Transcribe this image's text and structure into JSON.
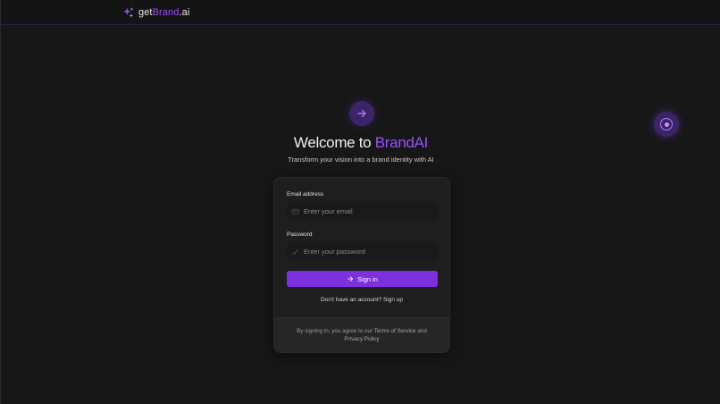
{
  "header": {
    "brand_prefix": "get",
    "brand_highlight": "Brand",
    "brand_suffix": ".ai",
    "logo_icon": "sparkles-icon"
  },
  "hero": {
    "icon": "arrow-right-icon",
    "title_prefix": "Welcome to ",
    "title_highlight": "BrandAI",
    "subtitle": "Transform your vision into a brand identity with AI"
  },
  "form": {
    "email_label": "Email address",
    "email_placeholder": "Enter your email",
    "email_value": "",
    "email_icon": "mail-icon",
    "password_label": "Password",
    "password_placeholder": "Enter your password",
    "password_value": "",
    "password_icon": "key-icon",
    "signin_label": "Sign in",
    "signin_icon": "arrow-right-icon",
    "signup_prompt": "Don't have an account?",
    "signup_link": "Sign up"
  },
  "footer": {
    "agree_text": "By signing in, you agree to our",
    "terms_link": "Terms of Service",
    "and_text": "and",
    "privacy_link": "Privacy Policy"
  },
  "floating": {
    "icon": "radio-target-icon"
  },
  "colors": {
    "accent": "#9b4dff",
    "button": "#7e2fe0",
    "background": "#171717",
    "card": "#1e1e1e"
  }
}
